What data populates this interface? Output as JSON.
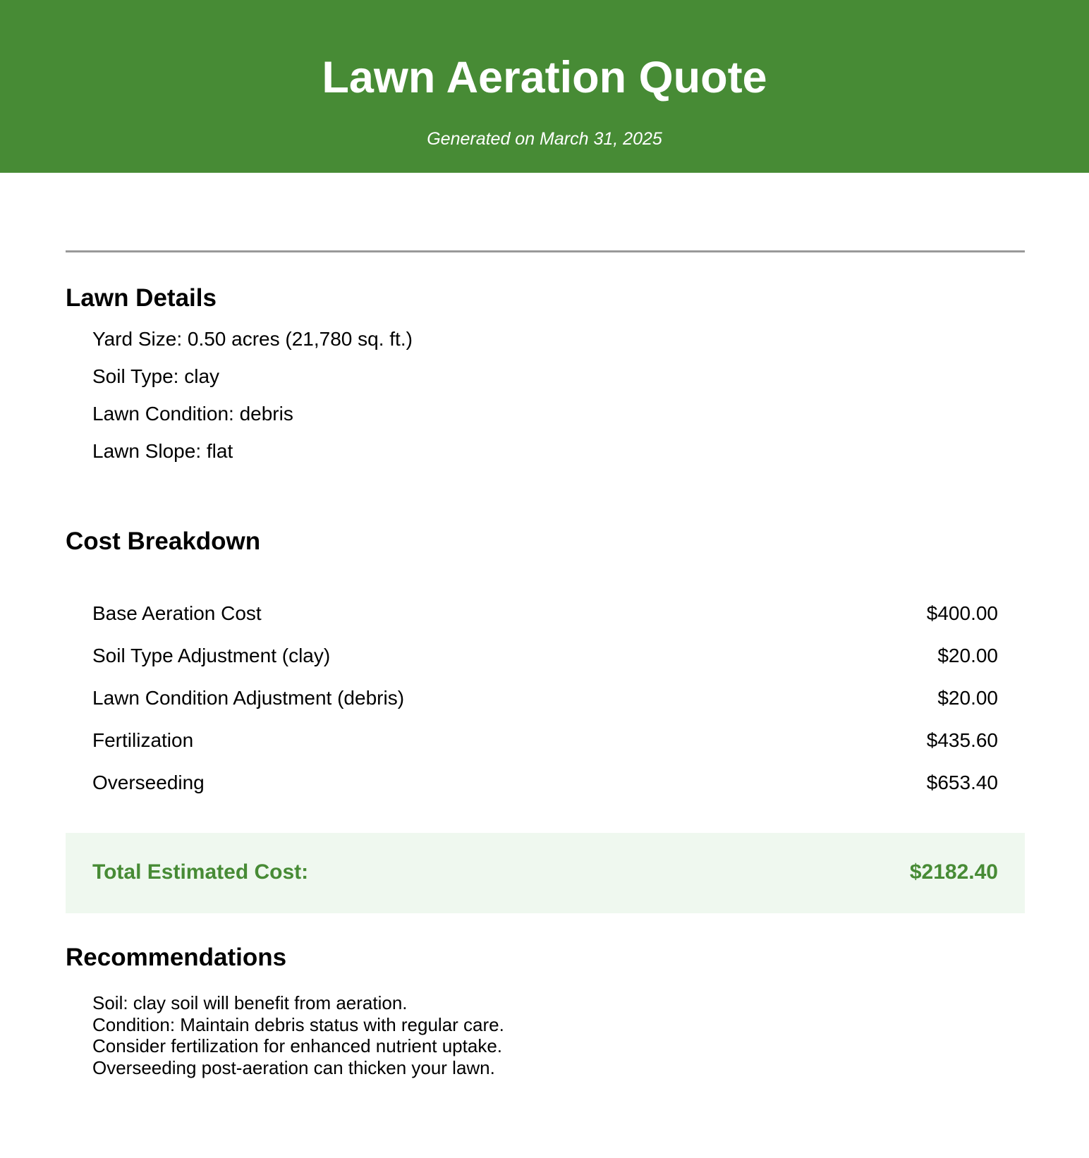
{
  "header": {
    "title": "Lawn Aeration Quote",
    "subtitle": "Generated on March 31, 2025",
    "background_color": "#478b35"
  },
  "lawn_details": {
    "heading": "Lawn Details",
    "items": [
      "Yard Size: 0.50 acres (21,780 sq. ft.)",
      "Soil Type: clay",
      "Lawn Condition: debris",
      "Lawn Slope: flat"
    ]
  },
  "cost_breakdown": {
    "heading": "Cost Breakdown",
    "rows": [
      {
        "label": "Base Aeration Cost",
        "amount": "$400.00"
      },
      {
        "label": "Soil Type Adjustment (clay)",
        "amount": "$20.00"
      },
      {
        "label": "Lawn Condition Adjustment (debris)",
        "amount": "$20.00"
      },
      {
        "label": "Fertilization",
        "amount": "$435.60"
      },
      {
        "label": "Overseeding",
        "amount": "$653.40"
      }
    ],
    "total_label": "Total Estimated Cost:",
    "total_amount": "$2182.40",
    "total_color": "#478b35",
    "total_background": "#eff8ef"
  },
  "recommendations": {
    "heading": "Recommendations",
    "lines": [
      "Soil: clay soil will benefit from aeration.",
      "Condition: Maintain debris status with regular care.",
      "Consider fertilization for enhanced nutrient uptake.",
      "Overseeding post-aeration can thicken your lawn."
    ]
  }
}
